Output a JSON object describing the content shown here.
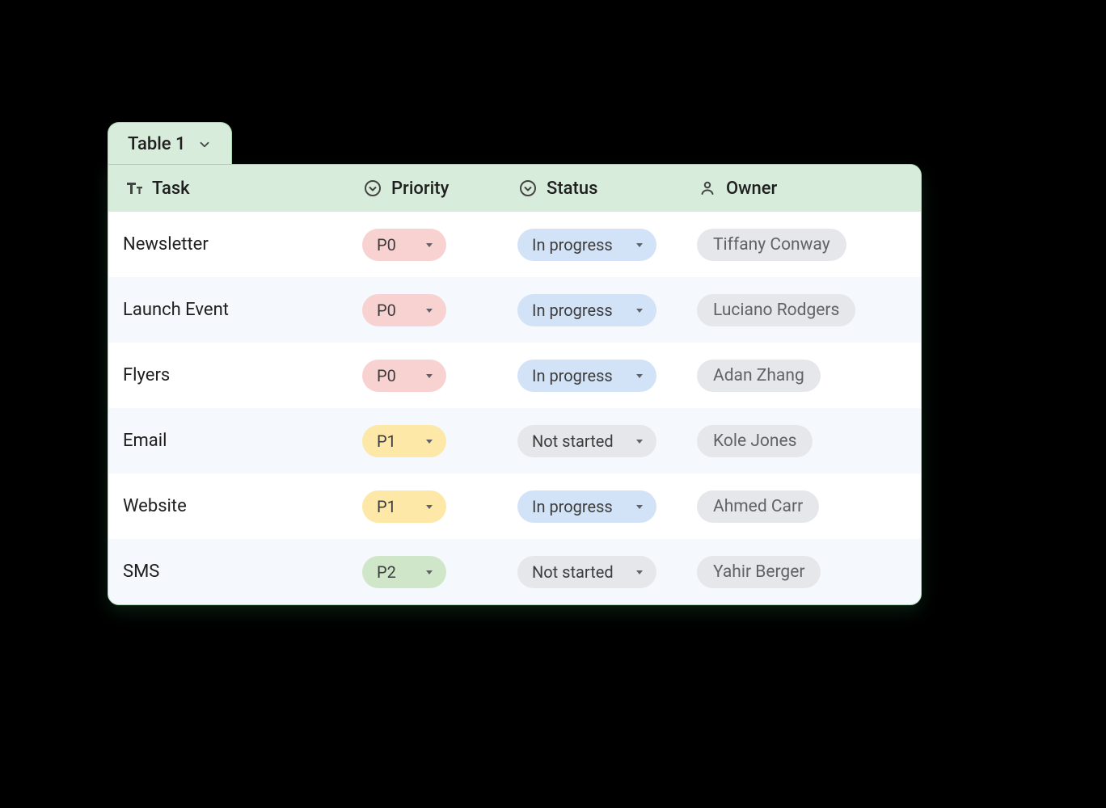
{
  "table": {
    "tab_label": "Table 1",
    "columns": {
      "task": "Task",
      "priority": "Priority",
      "status": "Status",
      "owner": "Owner"
    },
    "rows": [
      {
        "task": "Newsletter",
        "priority": "P0",
        "status": "In progress",
        "owner": "Tiffany Conway"
      },
      {
        "task": "Launch Event",
        "priority": "P0",
        "status": "In progress",
        "owner": "Luciano Rodgers"
      },
      {
        "task": "Flyers",
        "priority": "P0",
        "status": "In progress",
        "owner": "Adan Zhang"
      },
      {
        "task": "Email",
        "priority": "P1",
        "status": "Not started",
        "owner": "Kole Jones"
      },
      {
        "task": "Website",
        "priority": "P1",
        "status": "In progress",
        "owner": "Ahmed Carr"
      },
      {
        "task": "SMS",
        "priority": "P2",
        "status": "Not started",
        "owner": "Yahir Berger"
      }
    ]
  },
  "style_map": {
    "priority": {
      "P0": "p0",
      "P1": "p1",
      "P2": "p2"
    },
    "status": {
      "In progress": "st-inprogress",
      "Not started": "st-notstarted"
    }
  }
}
